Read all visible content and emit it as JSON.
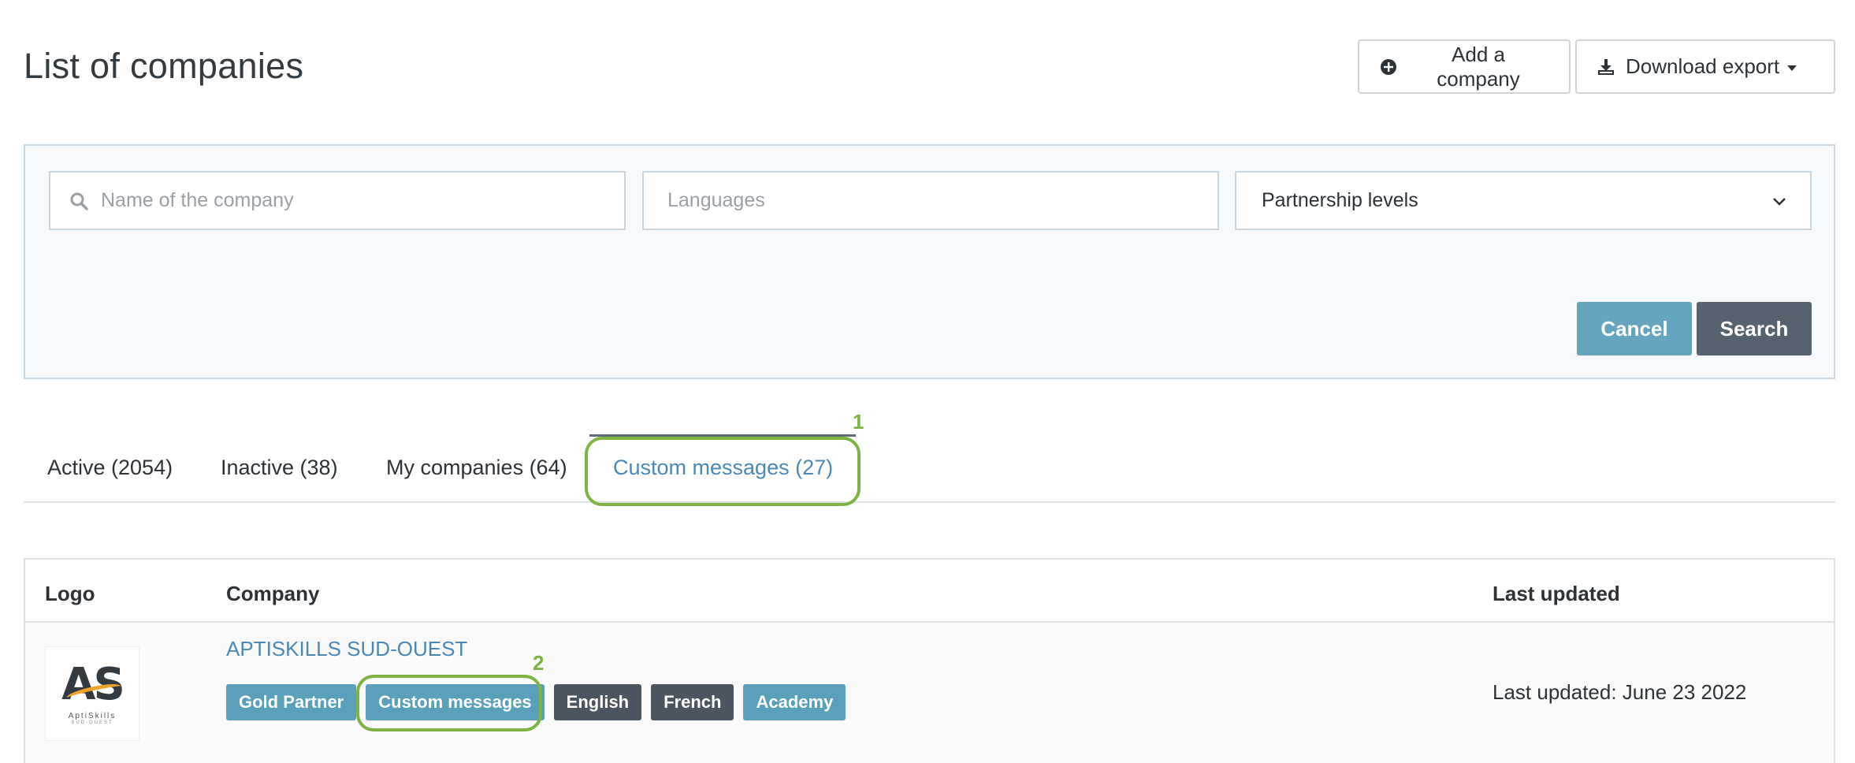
{
  "header": {
    "title": "List of companies",
    "add_label": "Add a company",
    "export_label": "Download export"
  },
  "filters": {
    "name_placeholder": "Name of the company",
    "languages_placeholder": "Languages",
    "partnership_value": "Partnership levels",
    "cancel_label": "Cancel",
    "search_label": "Search"
  },
  "tabs": [
    {
      "label": "Active (2054)"
    },
    {
      "label": "Inactive (38)"
    },
    {
      "label": "My companies (64)"
    },
    {
      "label": "Custom messages (27)"
    }
  ],
  "callouts": [
    "1",
    "2"
  ],
  "table": {
    "headers": {
      "logo": "Logo",
      "company": "Company",
      "updated": "Last updated"
    },
    "rows": [
      {
        "logo_text": "AS",
        "logo_sub": "AptiSkills",
        "logo_sub2": "SUD-OUEST",
        "company": "APTISKILLS SUD-OUEST",
        "badges": [
          "Gold Partner",
          "Custom messages",
          "English",
          "French",
          "Academy"
        ],
        "updated": "Last updated: June 23 2022"
      }
    ]
  },
  "colors": {
    "accent": "#4a88b8",
    "badge_blue": "#5aa0ba",
    "badge_dark": "#4b5660",
    "callout": "#7cb342"
  },
  "icons": [
    "plus-circle-icon",
    "download-icon",
    "search-icon",
    "chevron-down-icon"
  ]
}
